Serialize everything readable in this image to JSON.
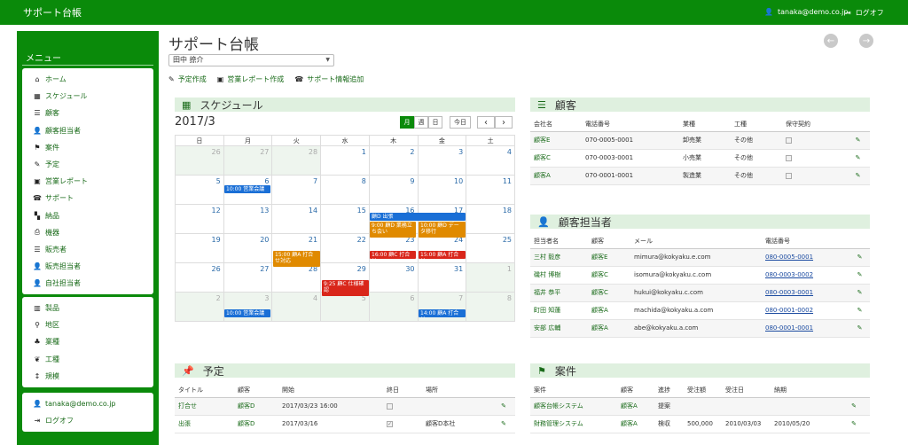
{
  "app": {
    "brand": "サポート台帳",
    "user_email": "tanaka@demo.co.jp",
    "logoff_label": "ログオフ"
  },
  "sidebar": {
    "title": "メニュー",
    "group1": [
      {
        "label": "ホーム",
        "icon": "home-icon"
      },
      {
        "label": "スケジュール",
        "icon": "calendar-icon"
      },
      {
        "label": "顧客",
        "icon": "list-icon"
      },
      {
        "label": "顧客担当者",
        "icon": "user-icon"
      },
      {
        "label": "案件",
        "icon": "flag-icon"
      },
      {
        "label": "予定",
        "icon": "pin-icon"
      },
      {
        "label": "営業レポート",
        "icon": "briefcase-icon"
      },
      {
        "label": "サポート",
        "icon": "phone-icon"
      },
      {
        "label": "納品",
        "icon": "grid-icon"
      },
      {
        "label": "機器",
        "icon": "printer-icon"
      },
      {
        "label": "販売者",
        "icon": "list-icon"
      },
      {
        "label": "販売担当者",
        "icon": "user-icon"
      },
      {
        "label": "自社担当者",
        "icon": "user-icon"
      }
    ],
    "group2": [
      {
        "label": "製品",
        "icon": "box-icon"
      },
      {
        "label": "地区",
        "icon": "map-marker-icon"
      },
      {
        "label": "業種",
        "icon": "tree-icon"
      },
      {
        "label": "工種",
        "icon": "leaf-icon"
      },
      {
        "label": "規模",
        "icon": "resize-icon"
      }
    ],
    "group3": [
      {
        "label": "tanaka@demo.co.jp",
        "icon": "user-icon"
      },
      {
        "label": "ログオフ",
        "icon": "logout-icon"
      }
    ]
  },
  "header": {
    "title": "サポート台帳",
    "staff_selected": "田中 捺介",
    "actions": [
      {
        "label": "予定作成",
        "icon": "pin-icon"
      },
      {
        "label": "営業レポート作成",
        "icon": "briefcase-icon"
      },
      {
        "label": "サポート情報追加",
        "icon": "phone-icon"
      }
    ]
  },
  "schedule": {
    "title": "スケジュール",
    "month_label": "2017/3",
    "view_buttons": [
      "月",
      "週",
      "日"
    ],
    "today_label": "今日",
    "prev_label": "‹",
    "next_label": "›",
    "weekdays": [
      "日",
      "月",
      "火",
      "水",
      "木",
      "金",
      "土"
    ],
    "weeks": [
      [
        "26",
        "27",
        "28",
        "1",
        "2",
        "3",
        "4"
      ],
      [
        "5",
        "6",
        "7",
        "8",
        "9",
        "10",
        "11"
      ],
      [
        "12",
        "13",
        "14",
        "15",
        "16",
        "17",
        "18"
      ],
      [
        "19",
        "20",
        "21",
        "22",
        "23",
        "24",
        "25"
      ],
      [
        "26",
        "27",
        "28",
        "29",
        "30",
        "31",
        "1"
      ],
      [
        "2",
        "3",
        "4",
        "5",
        "6",
        "7",
        "8"
      ]
    ],
    "events": [
      {
        "text": "10:00 営業会議",
        "color": "b"
      },
      {
        "text": "顧D 出張",
        "color": "b"
      },
      {
        "text": "9:00 顧D 業務立ち会い",
        "color": "o"
      },
      {
        "text": "10:00 顧D データ移行",
        "color": "o"
      },
      {
        "text": "15:00 顧A 打合せ対応",
        "color": "o"
      },
      {
        "text": "16:00 顧C 打合せ",
        "color": "r"
      },
      {
        "text": "15:00 顧A 打合せ",
        "color": "r"
      },
      {
        "text": "9:25 顧C 仕様確認",
        "color": "r"
      },
      {
        "text": "10:00 営業会議",
        "color": "b"
      },
      {
        "text": "14:00 顧A 打合せ",
        "color": "b"
      }
    ]
  },
  "customers": {
    "title": "顧客",
    "columns": [
      "会社名",
      "電話番号",
      "業種",
      "工種",
      "保守契約"
    ],
    "rows": [
      {
        "name": "顧客E",
        "tel": "070-0005-0001",
        "industry": "卸売業",
        "work": "その他"
      },
      {
        "name": "顧客C",
        "tel": "070-0003-0001",
        "industry": "小売業",
        "work": "その他"
      },
      {
        "name": "顧客A",
        "tel": "070-0001-0001",
        "industry": "製造業",
        "work": "その他"
      }
    ]
  },
  "contacts": {
    "title": "顧客担当者",
    "columns": [
      "担当者名",
      "顧客",
      "メール",
      "電話番号"
    ],
    "rows": [
      {
        "name": "三村 毅彦",
        "customer": "顧客E",
        "mail": "mimura@kokyaku.e.com",
        "tel": "080-0005-0001"
      },
      {
        "name": "磯村 博樹",
        "customer": "顧客C",
        "mail": "isomura@kokyaku.c.com",
        "tel": "080-0003-0002"
      },
      {
        "name": "福井 恭平",
        "customer": "顧客C",
        "mail": "hukui@kokyaku.c.com",
        "tel": "080-0003-0001"
      },
      {
        "name": "町田 知蓮",
        "customer": "顧客A",
        "mail": "machida@kokyaku.a.com",
        "tel": "080-0001-0002"
      },
      {
        "name": "安部 広輔",
        "customer": "顧客A",
        "mail": "abe@kokyaku.a.com",
        "tel": "080-0001-0001"
      }
    ]
  },
  "plans": {
    "title": "予定",
    "columns": [
      "タイトル",
      "顧客",
      "開始",
      "終日",
      "場所"
    ],
    "rows": [
      {
        "title": "打合せ",
        "customer": "顧客D",
        "start": "2017/03/23 16:00",
        "allday": false,
        "place": ""
      },
      {
        "title": "出張",
        "customer": "顧客D",
        "start": "2017/03/16",
        "allday": true,
        "place": "顧客D本社"
      }
    ]
  },
  "deals": {
    "title": "案件",
    "columns": [
      "案件",
      "顧客",
      "進捗",
      "受注額",
      "受注日",
      "納期"
    ],
    "rows": [
      {
        "name": "顧客台帳システム",
        "customer": "顧客A",
        "status": "提案",
        "amount": "",
        "order": "",
        "due": ""
      },
      {
        "name": "財務管理システム",
        "customer": "顧客A",
        "status": "検収",
        "amount": "500,000",
        "order": "2010/03/03",
        "due": "2010/05/20"
      }
    ]
  }
}
